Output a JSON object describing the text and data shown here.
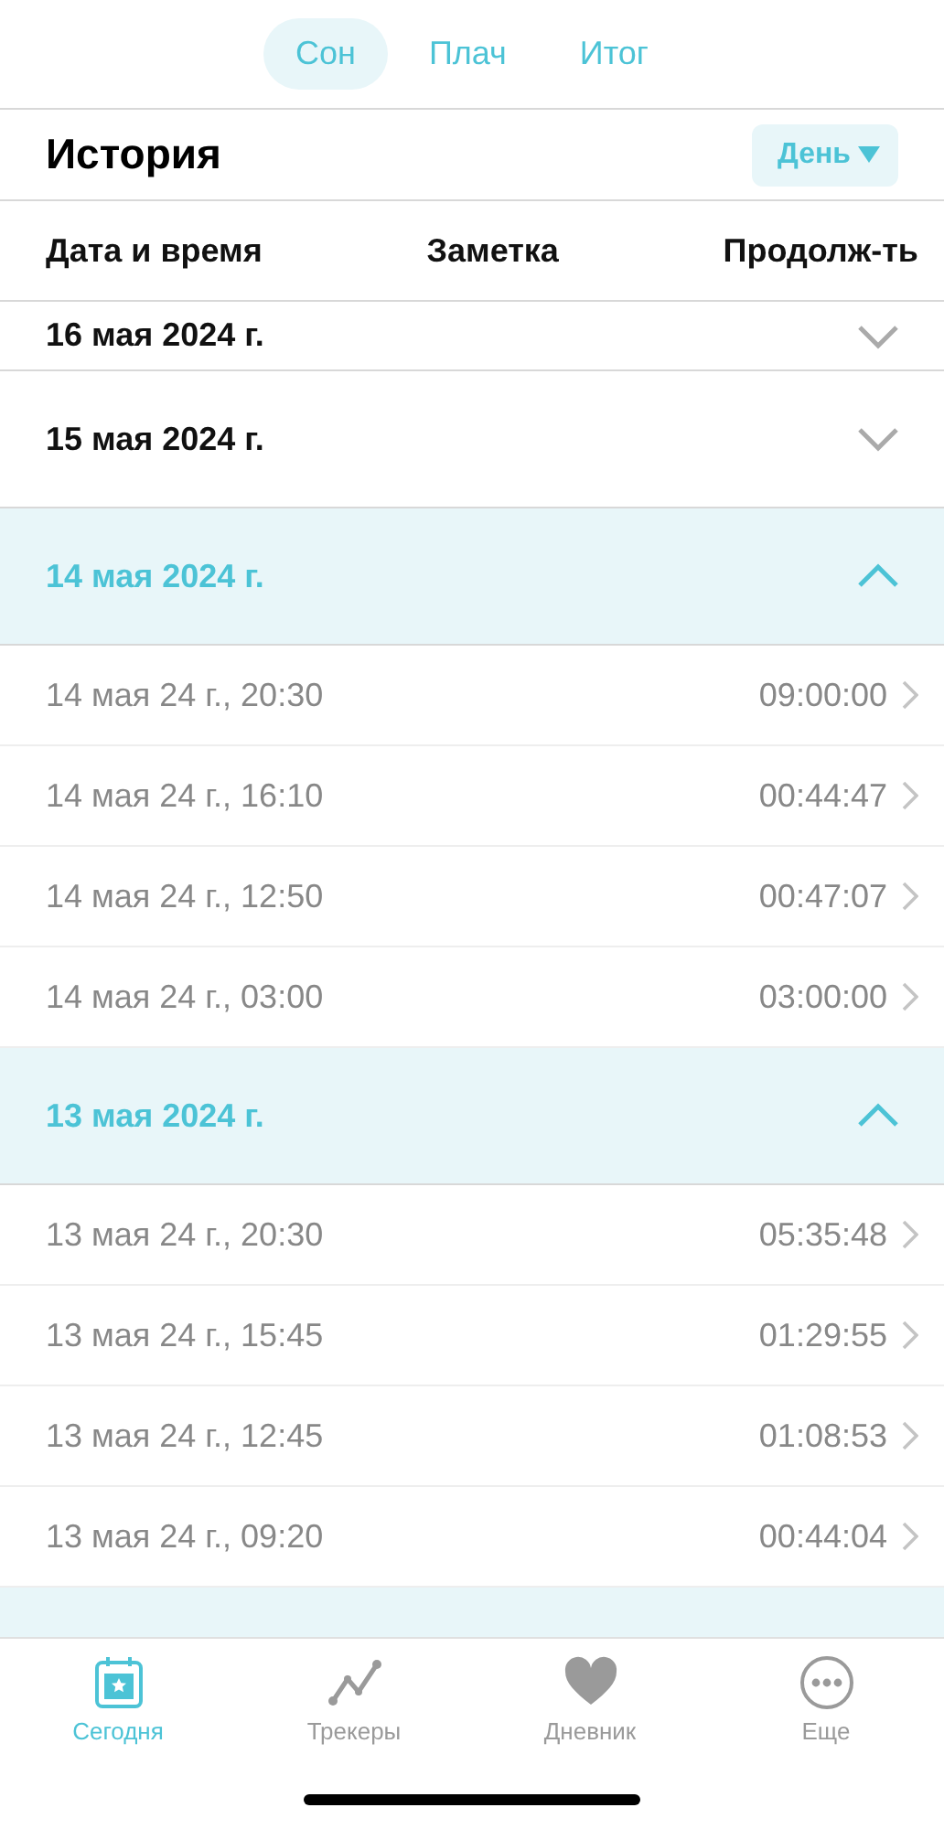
{
  "segments": [
    {
      "label": "Сон",
      "selected": true
    },
    {
      "label": "Плач",
      "selected": false
    },
    {
      "label": "Итог",
      "selected": false
    }
  ],
  "history": {
    "title": "История",
    "period": "День"
  },
  "columns": [
    "Дата и время",
    "Заметка",
    "Продолж-ть"
  ],
  "groups": [
    {
      "title": "16 мая 2024 г.",
      "expanded": false
    },
    {
      "title": "15 мая 2024 г.",
      "expanded": false
    },
    {
      "title": "14 мая 2024 г.",
      "expanded": true,
      "entries": [
        {
          "datetime": "14 мая 24 г., 20:30",
          "duration": "09:00:00"
        },
        {
          "datetime": "14 мая 24 г., 16:10",
          "duration": "00:44:47"
        },
        {
          "datetime": "14 мая 24 г., 12:50",
          "duration": "00:47:07"
        },
        {
          "datetime": "14 мая 24 г., 03:00",
          "duration": "03:00:00"
        }
      ]
    },
    {
      "title": "13 мая 2024 г.",
      "expanded": true,
      "entries": [
        {
          "datetime": "13 мая 24 г., 20:30",
          "duration": "05:35:48"
        },
        {
          "datetime": "13 мая 24 г., 15:45",
          "duration": "01:29:55"
        },
        {
          "datetime": "13 мая 24 г., 12:45",
          "duration": "01:08:53"
        },
        {
          "datetime": "13 мая 24 г., 09:20",
          "duration": "00:44:04"
        }
      ]
    }
  ],
  "tabbar": [
    {
      "kind": "calendar",
      "label": "Сегодня",
      "selected": true
    },
    {
      "kind": "chart",
      "label": "Трекеры",
      "selected": false
    },
    {
      "kind": "heart",
      "label": "Дневник",
      "selected": false
    },
    {
      "kind": "more",
      "label": "Еще",
      "selected": false
    }
  ]
}
